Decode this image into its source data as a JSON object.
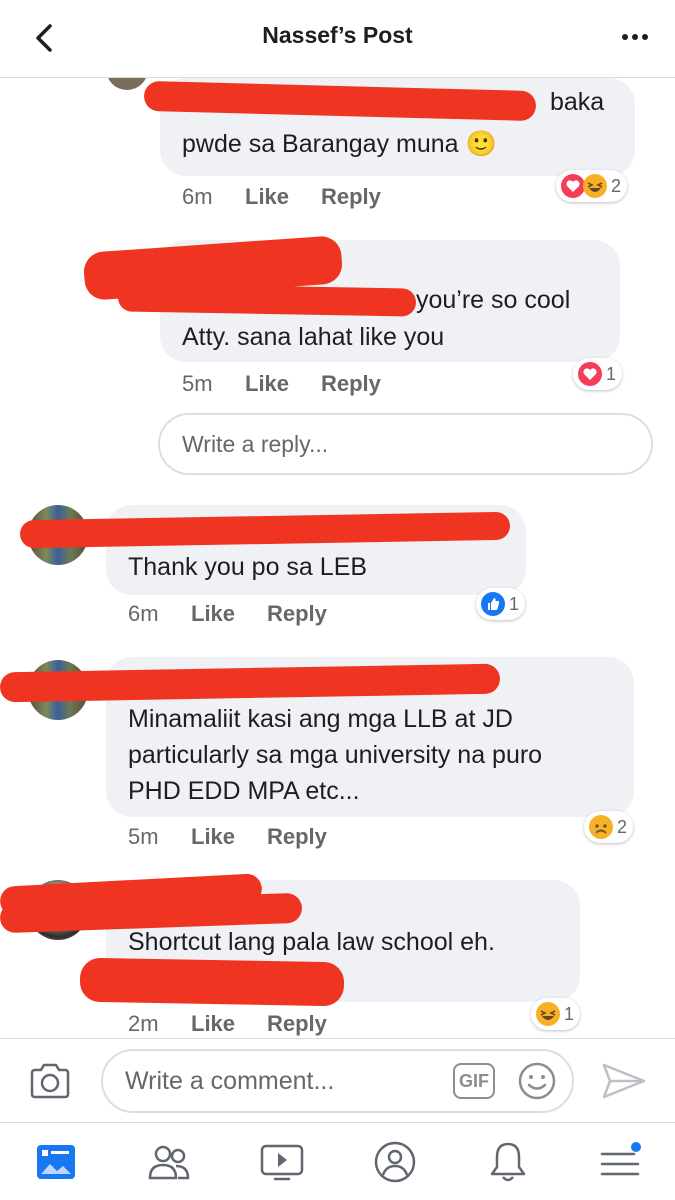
{
  "header": {
    "title": "Nassef’s Post"
  },
  "comments": [
    {
      "lines": [
        "baka",
        "pwde sa Barangay muna 🙂"
      ],
      "time": "6m",
      "like": "Like",
      "reply": "Reply",
      "reactions": {
        "icons": [
          "love-icon",
          "haha-icon"
        ],
        "count": "2"
      }
    },
    {
      "lines": [
        "you’re so cool",
        "Atty. sana lahat like you"
      ],
      "time": "5m",
      "like": "Like",
      "reply": "Reply",
      "reactions": {
        "icons": [
          "love-icon"
        ],
        "count": "1"
      }
    },
    {
      "lines": [
        "Thank you po sa LEB"
      ],
      "time": "6m",
      "like": "Like",
      "reply": "Reply",
      "reactions": {
        "icons": [
          "like-icon"
        ],
        "count": "1"
      }
    },
    {
      "lines": [
        "Minamaliit kasi ang mga LLB at JD",
        "particularly sa mga university na puro",
        "PHD EDD MPA etc..."
      ],
      "time": "5m",
      "like": "Like",
      "reply": "Reply",
      "reactions": {
        "icons": [
          "sad-icon"
        ],
        "count": "2"
      }
    },
    {
      "lines": [
        "Shortcut lang pala law school eh."
      ],
      "time": "2m",
      "like": "Like",
      "reply": "Reply",
      "reactions": {
        "icons": [
          "haha-icon"
        ],
        "count": "1"
      }
    }
  ],
  "reply_box": {
    "placeholder": "Write a reply..."
  },
  "composer": {
    "placeholder": "Write a comment...",
    "gif_label": "GIF"
  },
  "tabbar": {
    "tabs": [
      "news-feed-icon",
      "friends-icon",
      "watch-icon",
      "profile-icon",
      "notifications-icon",
      "menu-icon"
    ]
  },
  "colors": {
    "accent": "#1877f2",
    "redaction": "#ef3522",
    "bubble": "#f0f1f4",
    "meta": "#65676b"
  }
}
